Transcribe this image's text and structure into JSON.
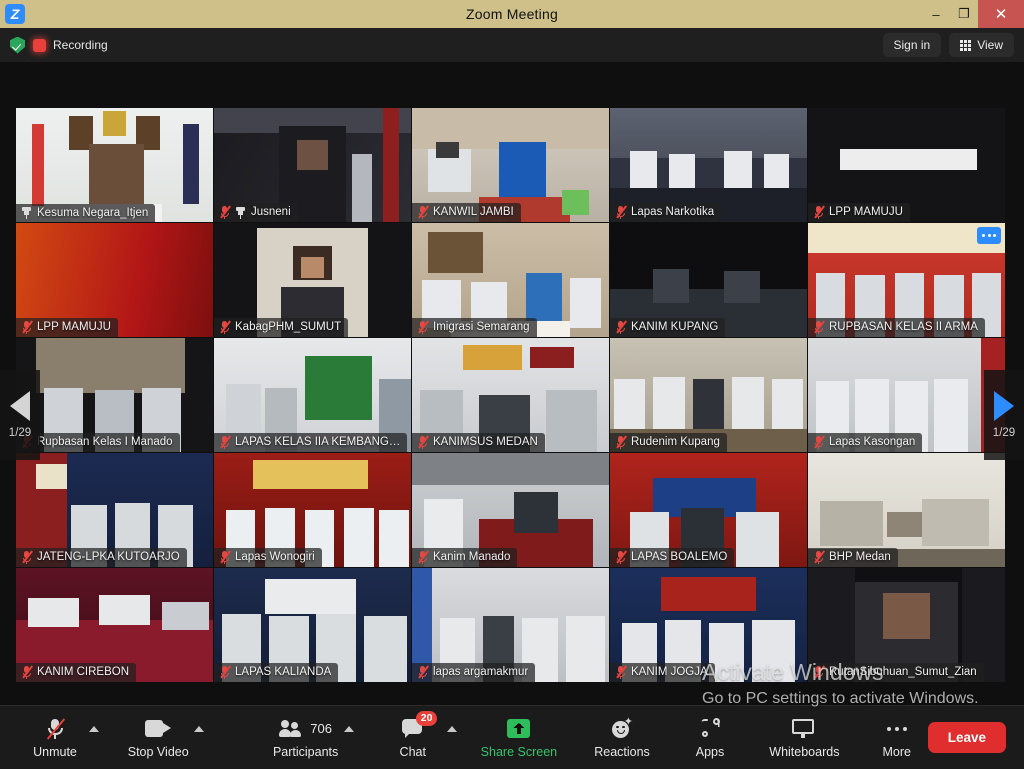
{
  "window": {
    "title": "Zoom Meeting",
    "logo": "Z",
    "minimize": "–",
    "restore": "❐",
    "close": "✕"
  },
  "topbar": {
    "encryption_icon": "shield-check-icon",
    "recording_icon": "recording-dot-icon",
    "recording_label": "Recording",
    "sign_in_label": "Sign in",
    "view_label": "View",
    "view_icon": "grid-icon"
  },
  "gallery": {
    "page_indicator": "1/29",
    "prev_icon": "chevron-left-icon",
    "next_icon": "chevron-right-icon",
    "more_options_icon": "ellipsis-icon",
    "tiles": [
      {
        "name": "Kesuma Negara_Itjen",
        "status": "pin",
        "active": true,
        "scene": "s-itjen",
        "more": false
      },
      {
        "name": "Jusneni",
        "status": "pin",
        "muted": true,
        "scene": "s-jusneni",
        "more": false
      },
      {
        "name": "KANWIL JAMBI",
        "status": "mute",
        "scene": "s-jambi",
        "more": false
      },
      {
        "name": "Lapas Narkotika",
        "status": "mute",
        "scene": "s-narkotika",
        "more": false
      },
      {
        "name": "LPP MAMUJU",
        "status": "mute",
        "scene": "s-mamuju1",
        "more": false
      },
      {
        "name": "LPP MAMUJU",
        "status": "mute",
        "scene": "s-mamuju2",
        "more": false
      },
      {
        "name": "KabagPHM_SUMUT",
        "status": "mute",
        "scene": "s-kabag",
        "more": false
      },
      {
        "name": "Imigrasi Semarang",
        "status": "mute",
        "scene": "s-semarang",
        "more": false
      },
      {
        "name": "KANIM KUPANG",
        "status": "mute",
        "scene": "s-kupang",
        "more": false
      },
      {
        "name": "RUPBASAN KELAS II ARMA",
        "status": "mute",
        "scene": "s-rupbasan2",
        "more": true
      },
      {
        "name": "Rupbasan Kelas I Manado",
        "status": "mute",
        "scene": "s-manado",
        "more": false
      },
      {
        "name": "LAPAS KELAS IIA KEMBANG…",
        "status": "mute",
        "scene": "s-kembang",
        "more": false
      },
      {
        "name": "KANIMSUS MEDAN",
        "status": "mute",
        "scene": "s-medan",
        "more": false
      },
      {
        "name": "Rudenim Kupang",
        "status": "mute",
        "scene": "s-rudenim",
        "more": false
      },
      {
        "name": "Lapas Kasongan",
        "status": "mute",
        "scene": "s-kasongan",
        "more": false
      },
      {
        "name": "JATENG-LPKA KUTOARJO",
        "status": "mute",
        "scene": "s-kutoarjo",
        "more": false
      },
      {
        "name": "Lapas Wonogiri",
        "status": "mute",
        "scene": "s-wonogiri",
        "more": false
      },
      {
        "name": "Kanim Manado",
        "status": "mute",
        "scene": "s-kmanado",
        "more": false
      },
      {
        "name": "LAPAS BOALEMO",
        "status": "mute",
        "scene": "s-boalemo",
        "more": false
      },
      {
        "name": "BHP Medan",
        "status": "mute",
        "scene": "s-bhp",
        "more": false
      },
      {
        "name": "KANIM CIREBON",
        "status": "mute",
        "scene": "s-cirebon",
        "more": false
      },
      {
        "name": "LAPAS KALIANDA",
        "status": "mute",
        "scene": "s-kalianda",
        "more": false
      },
      {
        "name": "lapas argamakmur",
        "status": "mute",
        "scene": "s-argamakmur",
        "more": false
      },
      {
        "name": "KANIM JOGJA",
        "status": "mute",
        "scene": "s-jogja",
        "more": false
      },
      {
        "name": "RutanSibuhuan_Sumut_Zian",
        "status": "mute",
        "scene": "s-sibuhuan",
        "more": false
      }
    ]
  },
  "watermark": {
    "line1": "Activate Windows",
    "line2": "Go to PC settings to activate Windows."
  },
  "toolbar": {
    "mute": {
      "label": "Unmute",
      "icon": "microphone-muted-icon"
    },
    "video": {
      "label": "Stop Video",
      "icon": "camera-icon"
    },
    "participants": {
      "label": "Participants",
      "icon": "people-icon",
      "count": "706"
    },
    "chat": {
      "label": "Chat",
      "icon": "chat-bubble-icon",
      "badge": "20"
    },
    "share": {
      "label": "Share Screen",
      "icon": "share-screen-icon"
    },
    "reactions": {
      "label": "Reactions",
      "icon": "smiley-icon"
    },
    "apps": {
      "label": "Apps",
      "icon": "apps-icon"
    },
    "whiteboards": {
      "label": "Whiteboards",
      "icon": "whiteboard-icon"
    },
    "more": {
      "label": "More",
      "icon": "ellipsis-icon"
    },
    "leave": {
      "label": "Leave"
    }
  },
  "colors": {
    "titlebar": "#cfc08a",
    "accent_blue": "#2d8cff",
    "leave_red": "#e02d2d",
    "share_green": "#2fbd5c",
    "active_speaker": "#f3e85f",
    "badge_red": "#e8413c"
  }
}
